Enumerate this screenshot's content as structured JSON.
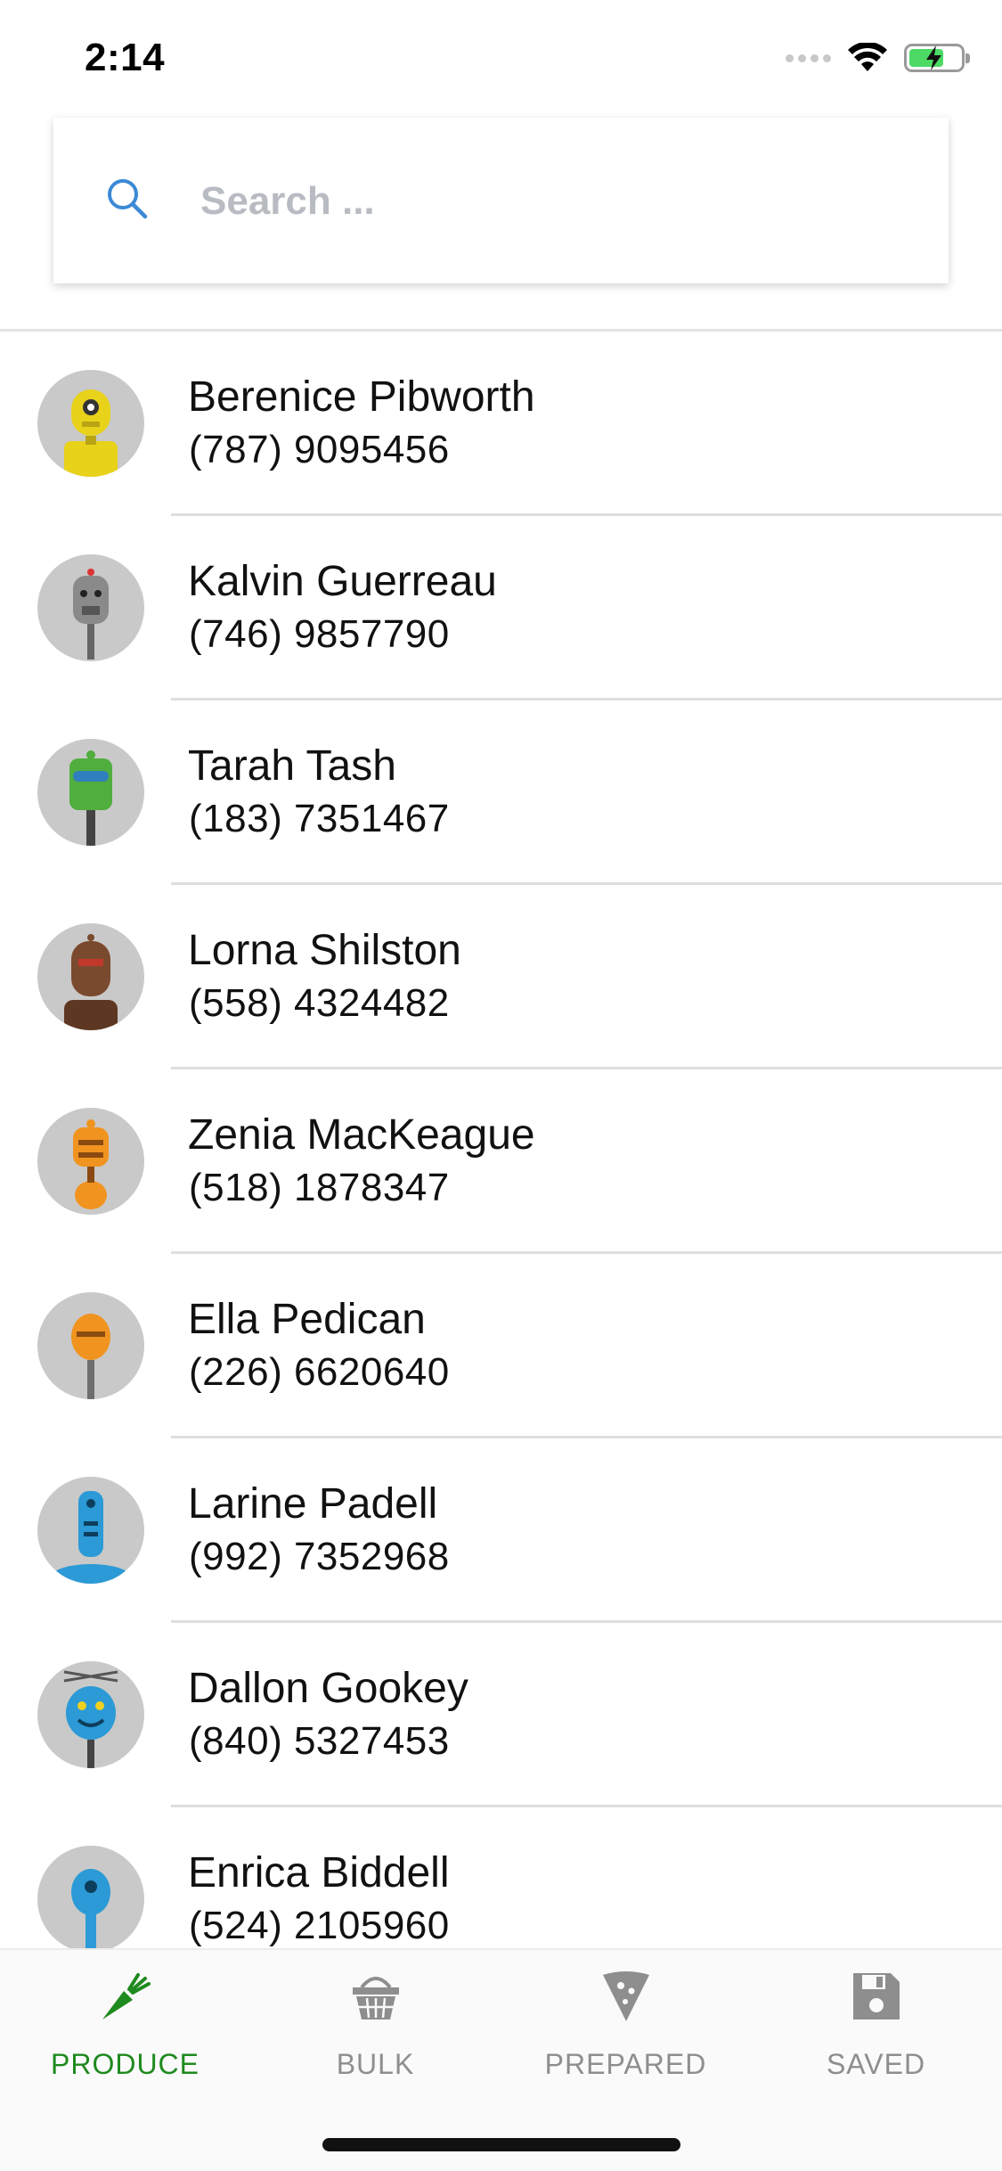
{
  "status_bar": {
    "time": "2:14"
  },
  "search": {
    "placeholder": "Search ..."
  },
  "contacts": [
    {
      "name": "Berenice Pibworth",
      "phone": "(787) 9095456",
      "avatar_color": "#e8d21a"
    },
    {
      "name": "Kalvin Guerreau",
      "phone": "(746) 9857790",
      "avatar_color": "#8a8a8a"
    },
    {
      "name": "Tarah Tash",
      "phone": "(183) 7351467",
      "avatar_color": "#4fae3e"
    },
    {
      "name": "Lorna Shilston",
      "phone": "(558) 4324482",
      "avatar_color": "#7a4a2e"
    },
    {
      "name": "Zenia MacKeague",
      "phone": "(518) 1878347",
      "avatar_color": "#f0941f"
    },
    {
      "name": "Ella Pedican",
      "phone": "(226) 6620640",
      "avatar_color": "#f0941f"
    },
    {
      "name": "Larine Padell",
      "phone": "(992) 7352968",
      "avatar_color": "#2b9ad6"
    },
    {
      "name": "Dallon Gookey",
      "phone": "(840) 5327453",
      "avatar_color": "#2b9ad6"
    },
    {
      "name": "Enrica Biddell",
      "phone": "(524) 2105960",
      "avatar_color": "#2b9ad6"
    }
  ],
  "tabs": [
    {
      "label": "PRODUCE",
      "icon": "carrot-icon",
      "active": true
    },
    {
      "label": "BULK",
      "icon": "basket-icon",
      "active": false
    },
    {
      "label": "PREPARED",
      "icon": "pizza-slice-icon",
      "active": false
    },
    {
      "label": "SAVED",
      "icon": "floppy-disk-icon",
      "active": false
    }
  ],
  "colors": {
    "active_tab": "#1f8a1f",
    "inactive_tab": "#8e8e8e",
    "search_icon": "#3b8ad6"
  }
}
